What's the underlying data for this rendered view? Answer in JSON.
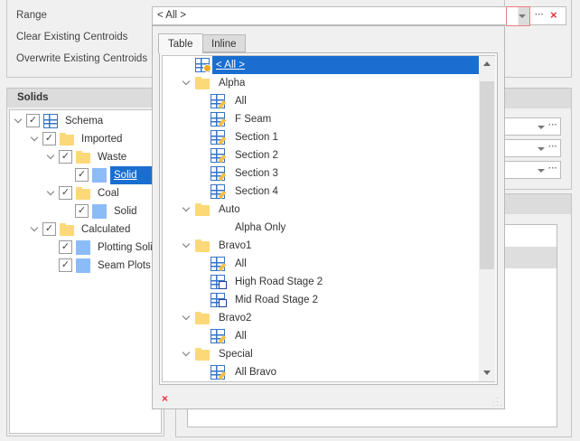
{
  "form": {
    "range_label": "Range",
    "clear_label": "Clear Existing Centroids",
    "overwrite_label": "Overwrite Existing Centroids",
    "range_value": "< All >"
  },
  "solids": {
    "title": "Solids",
    "tree": [
      {
        "label": "Schema",
        "level": 0,
        "icon": "table",
        "expanded": true,
        "checked": true
      },
      {
        "label": "Imported",
        "level": 1,
        "icon": "folder",
        "expanded": true,
        "checked": true
      },
      {
        "label": "Waste",
        "level": 2,
        "icon": "folder",
        "expanded": true,
        "checked": true
      },
      {
        "label": "Solid",
        "level": 3,
        "icon": "solid",
        "checked": true,
        "selected": true
      },
      {
        "label": "Coal",
        "level": 2,
        "icon": "folder",
        "expanded": true,
        "checked": true
      },
      {
        "label": "Solid",
        "level": 3,
        "icon": "solid",
        "checked": true
      },
      {
        "label": "Calculated",
        "level": 1,
        "icon": "folder",
        "expanded": true,
        "checked": true
      },
      {
        "label": "Plotting Solid",
        "level": 2,
        "icon": "solid",
        "checked": true
      },
      {
        "label": "Seam Plots",
        "level": 2,
        "icon": "solid",
        "checked": true
      }
    ]
  },
  "popup": {
    "tabs": [
      {
        "label": "Table",
        "active": true
      },
      {
        "label": "Inline",
        "active": false
      }
    ],
    "items": [
      {
        "label": "< All >",
        "level": 0,
        "icon": "table-all",
        "selected": true
      },
      {
        "label": "Alpha",
        "level": 0,
        "icon": "folder",
        "expanded": true
      },
      {
        "label": "All",
        "level": 1,
        "icon": "table-edit"
      },
      {
        "label": "F Seam",
        "level": 1,
        "icon": "table-edit"
      },
      {
        "label": "Section 1",
        "level": 1,
        "icon": "table-edit"
      },
      {
        "label": "Section 2",
        "level": 1,
        "icon": "table-edit"
      },
      {
        "label": "Section 3",
        "level": 1,
        "icon": "table-edit"
      },
      {
        "label": "Section 4",
        "level": 1,
        "icon": "table-edit"
      },
      {
        "label": "Auto",
        "level": 0,
        "icon": "folder",
        "expanded": true
      },
      {
        "label": "Alpha Only",
        "level": 1,
        "icon": "none"
      },
      {
        "label": "Bravo1",
        "level": 0,
        "icon": "folder",
        "expanded": true
      },
      {
        "label": "All",
        "level": 1,
        "icon": "table-edit"
      },
      {
        "label": "High Road Stage 2",
        "level": 1,
        "icon": "table-check"
      },
      {
        "label": "Mid Road Stage 2",
        "level": 1,
        "icon": "table-check"
      },
      {
        "label": "Bravo2",
        "level": 0,
        "icon": "folder",
        "expanded": true
      },
      {
        "label": "All",
        "level": 1,
        "icon": "table-edit"
      },
      {
        "label": "Special",
        "level": 0,
        "icon": "folder",
        "expanded": true
      },
      {
        "label": "All Bravo",
        "level": 1,
        "icon": "table-edit"
      }
    ]
  },
  "colors": {
    "accent": "#1a6ed0",
    "highlight": "#e8474f",
    "clear": "#e03040"
  }
}
